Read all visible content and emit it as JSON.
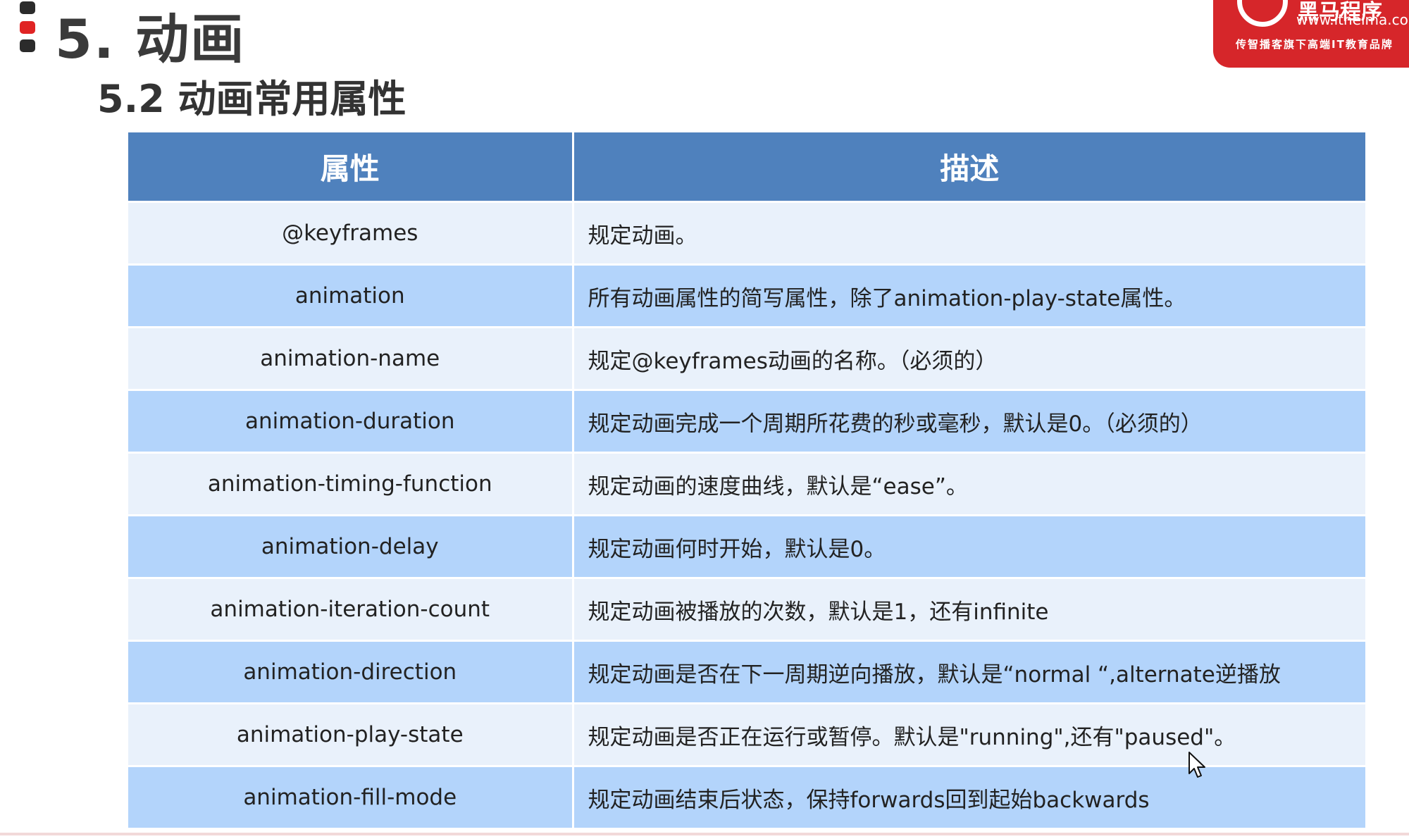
{
  "header": {
    "section_title": "5. 动画",
    "subsection_title": "5.2 动画常用属性"
  },
  "logo": {
    "brand_text": "黑马程序",
    "url": "www.itheima.com",
    "slogan": "传智播客旗下高端IT教育品牌"
  },
  "table": {
    "headers": [
      "属性",
      "描述"
    ],
    "rows": [
      {
        "property": "@keyframes",
        "description": "规定动画。"
      },
      {
        "property": "animation",
        "description": "所有动画属性的简写属性，除了animation-play-state属性。"
      },
      {
        "property": "animation-name",
        "description": "规定@keyframes动画的名称。（必须的）"
      },
      {
        "property": "animation-duration",
        "description": "规定动画完成一个周期所花费的秒或毫秒，默认是0。（必须的）"
      },
      {
        "property": "animation-timing-function",
        "description": "规定动画的速度曲线，默认是“ease”。"
      },
      {
        "property": "animation-delay",
        "description": "规定动画何时开始，默认是0。"
      },
      {
        "property": "animation-iteration-count",
        "description": "规定动画被播放的次数，默认是1，还有infinite"
      },
      {
        "property": "animation-direction",
        "description": "规定动画是否在下一周期逆向播放，默认是“normal “,alternate逆播放"
      },
      {
        "property": "animation-play-state",
        "description": "规定动画是否正在运行或暂停。默认是\"running\",还有\"paused\"。"
      },
      {
        "property": "animation-fill-mode",
        "description": "规定动画结束后状态，保持forwards回到起始backwards"
      }
    ]
  },
  "colors": {
    "header_bg": "#4f81bd",
    "row_light": "#e9f1fb",
    "row_dark": "#b3d4fb",
    "accent_red": "#e02424"
  }
}
